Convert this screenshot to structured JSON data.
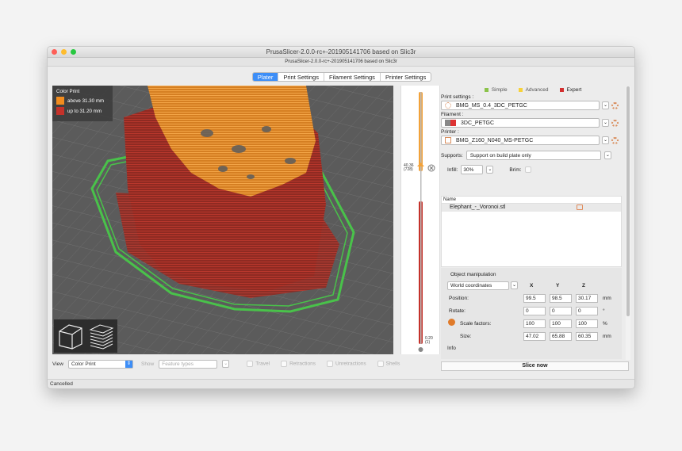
{
  "window": {
    "title": "PrusaSlicer-2.0.0-rc+-201905141706 based on Slic3r",
    "subtitle": "PrusaSlicer-2.0.0-rc+-201905141706 based on Slic3r"
  },
  "tabs": [
    {
      "label": "Plater",
      "active": true
    },
    {
      "label": "Print Settings",
      "active": false
    },
    {
      "label": "Filament Settings",
      "active": false
    },
    {
      "label": "Printer Settings",
      "active": false
    }
  ],
  "legend": {
    "title": "Color Print",
    "items": [
      {
        "label": "above 31.30 mm",
        "color": "#f28c1e"
      },
      {
        "label": "up to 31.20 mm",
        "color": "#c4322a"
      }
    ]
  },
  "slider": {
    "top_label": "40.36\n(728)",
    "bottom_label": "0.20\n(1)",
    "top_color": "#f2a23a",
    "bottom_color": "#c4322a"
  },
  "bottombar": {
    "view_label": "View",
    "view_value": "Color Print",
    "show_label": "Show",
    "feature_placeholder": "Feature types",
    "checks": [
      "Travel",
      "Retractions",
      "Unretractions",
      "Shells"
    ]
  },
  "modes": [
    {
      "label": "Simple",
      "color": "#8bc34a"
    },
    {
      "label": "Advanced",
      "color": "#f7d23a"
    },
    {
      "label": "Expert",
      "color": "#d32f2f"
    }
  ],
  "print_settings": {
    "label": "Print settings :",
    "value": "BMG_MS_0.4_3DC_PETGC"
  },
  "filament": {
    "label": "Filament :",
    "value": "3DC_PETGC"
  },
  "printer": {
    "label": "Printer :",
    "value": "BMG_Z160_N040_MS-PETGC"
  },
  "supports": {
    "label": "Supports:",
    "value": "Support on build plate only"
  },
  "infill": {
    "label": "Infill:",
    "value": "30%"
  },
  "brim": {
    "label": "Brim:"
  },
  "object_list": {
    "header": "Name",
    "items": [
      "Elephant_-_Voronoi.stl"
    ]
  },
  "manipulation": {
    "title": "Object manipulation",
    "coord_system": "World coordinates",
    "axes": [
      "X",
      "Y",
      "Z"
    ],
    "rows": [
      {
        "label": "Position:",
        "values": [
          "99.5",
          "98.5",
          "30.17"
        ],
        "unit": "mm"
      },
      {
        "label": "Rotate:",
        "values": [
          "0",
          "0",
          "0"
        ],
        "unit": "°"
      },
      {
        "label": "Scale factors:",
        "values": [
          "100",
          "100",
          "100"
        ],
        "unit": "%"
      },
      {
        "label": "Size:",
        "values": [
          "47.02",
          "65.88",
          "60.35"
        ],
        "unit": "mm"
      }
    ]
  },
  "info_label": "Info",
  "slice_button": "Slice now",
  "status": "Cancelled"
}
